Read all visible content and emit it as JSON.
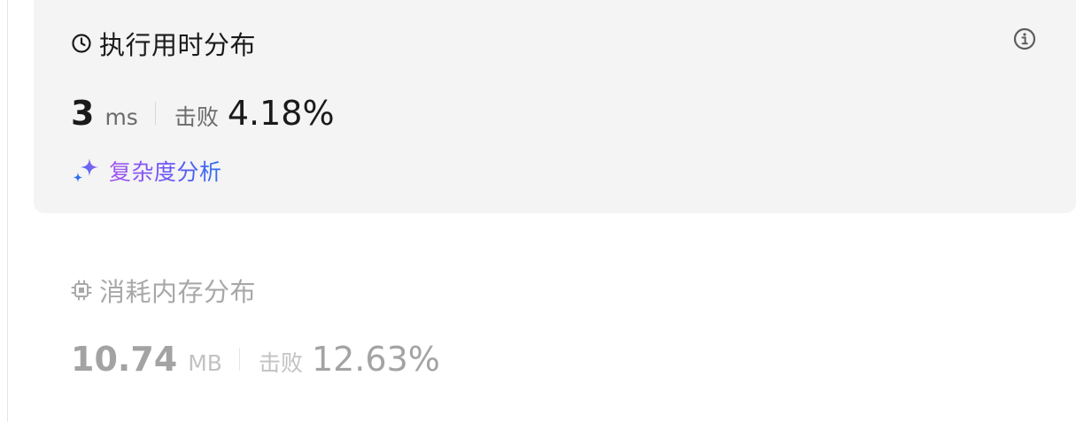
{
  "runtime": {
    "title": "执行用时分布",
    "value": "3",
    "unit": "ms",
    "beat_label": "击败",
    "beat_percent": "4.18%",
    "analysis_link": "复杂度分析",
    "icons": {
      "title": "clock-icon",
      "info": "info-icon",
      "link": "sparkle-icon"
    }
  },
  "memory": {
    "title": "消耗内存分布",
    "value": "10.74",
    "unit": "MB",
    "beat_label": "击败",
    "beat_percent": "12.63%",
    "icons": {
      "title": "chip-icon"
    }
  },
  "colors": {
    "card_background": "#f4f4f4",
    "primary_text": "#1a1a1a",
    "muted_text": "#a8a8a8",
    "gradient_start": "#a757f0",
    "gradient_end": "#2f6ff0"
  }
}
